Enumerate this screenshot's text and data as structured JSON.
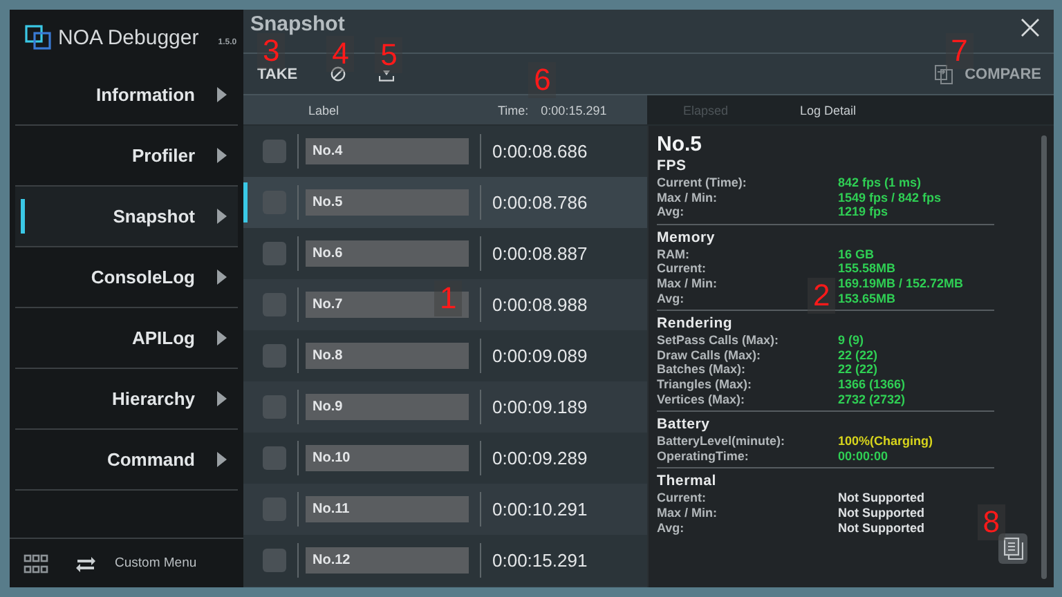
{
  "app": {
    "title": "NOA Debugger",
    "version": "1.5.0"
  },
  "sidebar": {
    "items": [
      {
        "label": "Information",
        "selected": false
      },
      {
        "label": "Profiler",
        "selected": false
      },
      {
        "label": "Snapshot",
        "selected": true
      },
      {
        "label": "ConsoleLog",
        "selected": false
      },
      {
        "label": "APILog",
        "selected": false
      },
      {
        "label": "Hierarchy",
        "selected": false
      },
      {
        "label": "Command",
        "selected": false
      }
    ],
    "footer": {
      "label": "Custom Menu"
    }
  },
  "window": {
    "title": "Snapshot"
  },
  "toolbar": {
    "take": {
      "label": "TAKE",
      "callout": "3"
    },
    "clear": {
      "callout": "4"
    },
    "download": {
      "callout": "5"
    },
    "compare": {
      "label": "COMPARE",
      "callout": "7"
    }
  },
  "table": {
    "columns": {
      "label": "Label",
      "time": "Time:",
      "total": "0:00:15.291",
      "elapsed": "Elapsed",
      "detail": "Log Detail"
    },
    "time_callout": "6",
    "callout": "1",
    "rows": [
      {
        "label": "No.4",
        "time": "0:00:08.686",
        "checked": false,
        "selected": false
      },
      {
        "label": "No.5",
        "time": "0:00:08.786",
        "checked": false,
        "selected": true
      },
      {
        "label": "No.6",
        "time": "0:00:08.887",
        "checked": false,
        "selected": false
      },
      {
        "label": "No.7",
        "time": "0:00:08.988",
        "checked": false,
        "selected": false
      },
      {
        "label": "No.8",
        "time": "0:00:09.089",
        "checked": false,
        "selected": false
      },
      {
        "label": "No.9",
        "time": "0:00:09.189",
        "checked": false,
        "selected": false
      },
      {
        "label": "No.10",
        "time": "0:00:09.289",
        "checked": false,
        "selected": false
      },
      {
        "label": "No.11",
        "time": "0:00:10.291",
        "checked": false,
        "selected": false
      },
      {
        "label": "No.12",
        "time": "0:00:15.291",
        "checked": false,
        "selected": false
      }
    ]
  },
  "detail": {
    "title": "No.5",
    "callout": "2",
    "copy_callout": "8",
    "sections": [
      {
        "title": "FPS",
        "items": [
          {
            "label": "Current (Time):",
            "value": "842 fps (1 ms)",
            "color": "#2fcf54"
          },
          {
            "label": "Max / Min:",
            "value": "1549 fps / 842 fps",
            "color": "#2fcf54"
          },
          {
            "label": "Avg:",
            "value": "1219 fps",
            "color": "#2fcf54"
          }
        ]
      },
      {
        "title": "Memory",
        "items": [
          {
            "label": "RAM:",
            "value": "16 GB",
            "color": "#2fcf54"
          },
          {
            "label": "Current:",
            "value": "155.58MB",
            "color": "#2fcf54"
          },
          {
            "label": "Max / Min:",
            "value": "169.19MB / 152.72MB",
            "color": "#2fcf54"
          },
          {
            "label": "Avg:",
            "value": "153.65MB",
            "color": "#2fcf54"
          }
        ]
      },
      {
        "title": "Rendering",
        "items": [
          {
            "label": "SetPass Calls (Max):",
            "value": "9 (9)",
            "color": "#2fcf54"
          },
          {
            "label": "Draw Calls (Max):",
            "value": "22 (22)",
            "color": "#2fcf54"
          },
          {
            "label": "Batches (Max):",
            "value": "22 (22)",
            "color": "#2fcf54"
          },
          {
            "label": "Triangles (Max):",
            "value": "1366 (1366)",
            "color": "#2fcf54"
          },
          {
            "label": "Vertices (Max):",
            "value": "2732 (2732)",
            "color": "#2fcf54"
          }
        ]
      },
      {
        "title": "Battery",
        "items": [
          {
            "label": "BatteryLevel(minute):",
            "value": "100%(Charging)",
            "color": "#d8d51c"
          },
          {
            "label": "OperatingTime:",
            "value": "00:00:00",
            "color": "#2fcf54"
          }
        ]
      },
      {
        "title": "Thermal",
        "items": [
          {
            "label": "Current:",
            "value": "Not Supported",
            "color": "#dfe2e4"
          },
          {
            "label": "Max / Min:",
            "value": "Not Supported",
            "color": "#dfe2e4"
          },
          {
            "label": "Avg:",
            "value": "Not Supported",
            "color": "#dfe2e4"
          }
        ]
      }
    ]
  }
}
